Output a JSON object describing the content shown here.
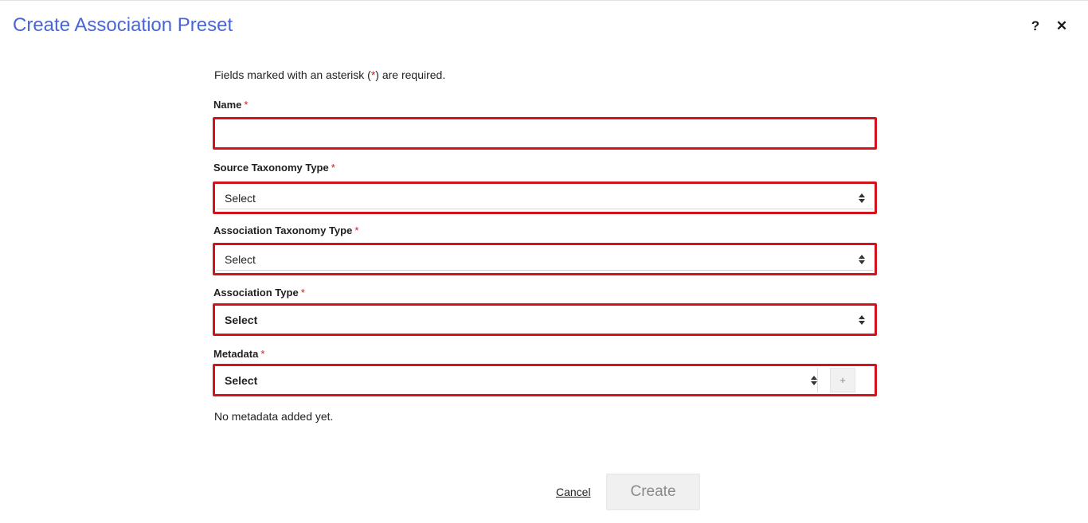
{
  "dialog": {
    "title": "Create Association Preset",
    "help_label": "?",
    "close_label": "✕"
  },
  "form": {
    "required_note_prefix": "Fields marked with an asterisk (",
    "required_note_star": "*",
    "required_note_suffix": ") are required.",
    "required_marker": "*",
    "name": {
      "label": "Name",
      "value": ""
    },
    "source_taxonomy_type": {
      "label": "Source Taxonomy Type",
      "value": "Select"
    },
    "association_taxonomy_type": {
      "label": "Association Taxonomy Type",
      "value": "Select"
    },
    "association_type": {
      "label": "Association Type",
      "value": "Select"
    },
    "metadata": {
      "label": "Metadata",
      "value": "Select",
      "add_label": "+"
    },
    "no_metadata_text": "No metadata added yet."
  },
  "actions": {
    "cancel_label": "Cancel",
    "create_label": "Create"
  },
  "colors": {
    "title": "#4a66d6",
    "required_border": "#d0131d",
    "asterisk": "#d11b1b"
  }
}
